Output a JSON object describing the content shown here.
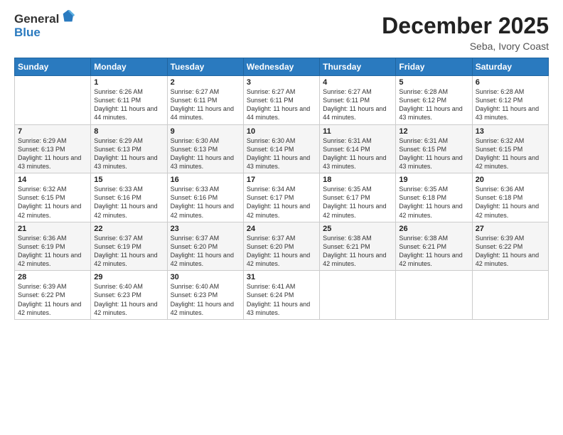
{
  "logo": {
    "general": "General",
    "blue": "Blue"
  },
  "title": "December 2025",
  "location": "Seba, Ivory Coast",
  "weekdays": [
    "Sunday",
    "Monday",
    "Tuesday",
    "Wednesday",
    "Thursday",
    "Friday",
    "Saturday"
  ],
  "weeks": [
    [
      {
        "day": "",
        "sunrise": "",
        "sunset": "",
        "daylight": ""
      },
      {
        "day": "1",
        "sunrise": "Sunrise: 6:26 AM",
        "sunset": "Sunset: 6:11 PM",
        "daylight": "Daylight: 11 hours and 44 minutes."
      },
      {
        "day": "2",
        "sunrise": "Sunrise: 6:27 AM",
        "sunset": "Sunset: 6:11 PM",
        "daylight": "Daylight: 11 hours and 44 minutes."
      },
      {
        "day": "3",
        "sunrise": "Sunrise: 6:27 AM",
        "sunset": "Sunset: 6:11 PM",
        "daylight": "Daylight: 11 hours and 44 minutes."
      },
      {
        "day": "4",
        "sunrise": "Sunrise: 6:27 AM",
        "sunset": "Sunset: 6:11 PM",
        "daylight": "Daylight: 11 hours and 44 minutes."
      },
      {
        "day": "5",
        "sunrise": "Sunrise: 6:28 AM",
        "sunset": "Sunset: 6:12 PM",
        "daylight": "Daylight: 11 hours and 43 minutes."
      },
      {
        "day": "6",
        "sunrise": "Sunrise: 6:28 AM",
        "sunset": "Sunset: 6:12 PM",
        "daylight": "Daylight: 11 hours and 43 minutes."
      }
    ],
    [
      {
        "day": "7",
        "sunrise": "Sunrise: 6:29 AM",
        "sunset": "Sunset: 6:13 PM",
        "daylight": "Daylight: 11 hours and 43 minutes."
      },
      {
        "day": "8",
        "sunrise": "Sunrise: 6:29 AM",
        "sunset": "Sunset: 6:13 PM",
        "daylight": "Daylight: 11 hours and 43 minutes."
      },
      {
        "day": "9",
        "sunrise": "Sunrise: 6:30 AM",
        "sunset": "Sunset: 6:13 PM",
        "daylight": "Daylight: 11 hours and 43 minutes."
      },
      {
        "day": "10",
        "sunrise": "Sunrise: 6:30 AM",
        "sunset": "Sunset: 6:14 PM",
        "daylight": "Daylight: 11 hours and 43 minutes."
      },
      {
        "day": "11",
        "sunrise": "Sunrise: 6:31 AM",
        "sunset": "Sunset: 6:14 PM",
        "daylight": "Daylight: 11 hours and 43 minutes."
      },
      {
        "day": "12",
        "sunrise": "Sunrise: 6:31 AM",
        "sunset": "Sunset: 6:15 PM",
        "daylight": "Daylight: 11 hours and 43 minutes."
      },
      {
        "day": "13",
        "sunrise": "Sunrise: 6:32 AM",
        "sunset": "Sunset: 6:15 PM",
        "daylight": "Daylight: 11 hours and 42 minutes."
      }
    ],
    [
      {
        "day": "14",
        "sunrise": "Sunrise: 6:32 AM",
        "sunset": "Sunset: 6:15 PM",
        "daylight": "Daylight: 11 hours and 42 minutes."
      },
      {
        "day": "15",
        "sunrise": "Sunrise: 6:33 AM",
        "sunset": "Sunset: 6:16 PM",
        "daylight": "Daylight: 11 hours and 42 minutes."
      },
      {
        "day": "16",
        "sunrise": "Sunrise: 6:33 AM",
        "sunset": "Sunset: 6:16 PM",
        "daylight": "Daylight: 11 hours and 42 minutes."
      },
      {
        "day": "17",
        "sunrise": "Sunrise: 6:34 AM",
        "sunset": "Sunset: 6:17 PM",
        "daylight": "Daylight: 11 hours and 42 minutes."
      },
      {
        "day": "18",
        "sunrise": "Sunrise: 6:35 AM",
        "sunset": "Sunset: 6:17 PM",
        "daylight": "Daylight: 11 hours and 42 minutes."
      },
      {
        "day": "19",
        "sunrise": "Sunrise: 6:35 AM",
        "sunset": "Sunset: 6:18 PM",
        "daylight": "Daylight: 11 hours and 42 minutes."
      },
      {
        "day": "20",
        "sunrise": "Sunrise: 6:36 AM",
        "sunset": "Sunset: 6:18 PM",
        "daylight": "Daylight: 11 hours and 42 minutes."
      }
    ],
    [
      {
        "day": "21",
        "sunrise": "Sunrise: 6:36 AM",
        "sunset": "Sunset: 6:19 PM",
        "daylight": "Daylight: 11 hours and 42 minutes."
      },
      {
        "day": "22",
        "sunrise": "Sunrise: 6:37 AM",
        "sunset": "Sunset: 6:19 PM",
        "daylight": "Daylight: 11 hours and 42 minutes."
      },
      {
        "day": "23",
        "sunrise": "Sunrise: 6:37 AM",
        "sunset": "Sunset: 6:20 PM",
        "daylight": "Daylight: 11 hours and 42 minutes."
      },
      {
        "day": "24",
        "sunrise": "Sunrise: 6:37 AM",
        "sunset": "Sunset: 6:20 PM",
        "daylight": "Daylight: 11 hours and 42 minutes."
      },
      {
        "day": "25",
        "sunrise": "Sunrise: 6:38 AM",
        "sunset": "Sunset: 6:21 PM",
        "daylight": "Daylight: 11 hours and 42 minutes."
      },
      {
        "day": "26",
        "sunrise": "Sunrise: 6:38 AM",
        "sunset": "Sunset: 6:21 PM",
        "daylight": "Daylight: 11 hours and 42 minutes."
      },
      {
        "day": "27",
        "sunrise": "Sunrise: 6:39 AM",
        "sunset": "Sunset: 6:22 PM",
        "daylight": "Daylight: 11 hours and 42 minutes."
      }
    ],
    [
      {
        "day": "28",
        "sunrise": "Sunrise: 6:39 AM",
        "sunset": "Sunset: 6:22 PM",
        "daylight": "Daylight: 11 hours and 42 minutes."
      },
      {
        "day": "29",
        "sunrise": "Sunrise: 6:40 AM",
        "sunset": "Sunset: 6:23 PM",
        "daylight": "Daylight: 11 hours and 42 minutes."
      },
      {
        "day": "30",
        "sunrise": "Sunrise: 6:40 AM",
        "sunset": "Sunset: 6:23 PM",
        "daylight": "Daylight: 11 hours and 42 minutes."
      },
      {
        "day": "31",
        "sunrise": "Sunrise: 6:41 AM",
        "sunset": "Sunset: 6:24 PM",
        "daylight": "Daylight: 11 hours and 43 minutes."
      },
      {
        "day": "",
        "sunrise": "",
        "sunset": "",
        "daylight": ""
      },
      {
        "day": "",
        "sunrise": "",
        "sunset": "",
        "daylight": ""
      },
      {
        "day": "",
        "sunrise": "",
        "sunset": "",
        "daylight": ""
      }
    ]
  ]
}
